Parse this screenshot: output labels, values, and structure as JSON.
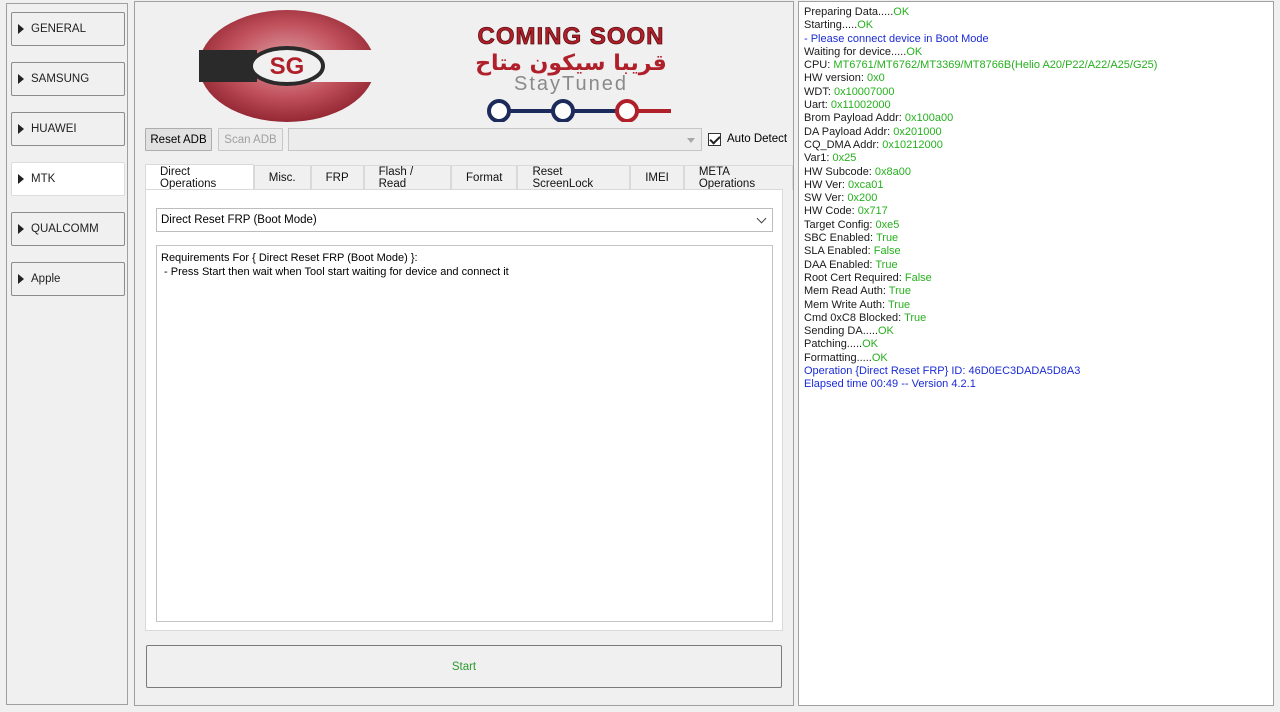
{
  "nav": {
    "items": [
      {
        "label": "GENERAL"
      },
      {
        "label": "SAMSUNG"
      },
      {
        "label": "HUAWEI"
      },
      {
        "label": "MTK",
        "active": true
      },
      {
        "label": "QUALCOMM"
      },
      {
        "label": "Apple"
      }
    ]
  },
  "banner": {
    "logo_text": "SG",
    "headline": "COMING SOON",
    "arabic_line": "قريبا سيكون متاح",
    "tagline": "StayTuned"
  },
  "toolbar": {
    "reset_adb_label": "Reset ADB",
    "scan_adb_label": "Scan ADB",
    "port_value": "",
    "auto_detect_label": "Auto Detect",
    "auto_detect_checked": true
  },
  "tabs": [
    {
      "label": "Direct Operations",
      "active": true
    },
    {
      "label": "Misc."
    },
    {
      "label": "FRP"
    },
    {
      "label": "Flash / Read"
    },
    {
      "label": "Format"
    },
    {
      "label": "Reset ScreenLock"
    },
    {
      "label": "IMEI"
    },
    {
      "label": "META Operations"
    }
  ],
  "operation": {
    "selected": "Direct Reset FRP (Boot Mode)",
    "requirements": "Requirements For { Direct Reset FRP (Boot Mode) }:\n - Press Start then wait when Tool start waiting for device and connect it"
  },
  "start_label": "Start",
  "colors": {
    "log_default": "#1a1a1a",
    "log_value": "#26b01e",
    "log_info": "#1b2bd6",
    "start_text": "#2e9a2e",
    "banner_red": "#b0202a",
    "banner_navy": "#1c2a5c"
  },
  "log": [
    [
      {
        "t": "Preparing Data.....",
        "c": "black"
      },
      {
        "t": "OK",
        "c": "green"
      }
    ],
    [
      {
        "t": "Starting.....",
        "c": "black"
      },
      {
        "t": "OK",
        "c": "green"
      }
    ],
    [
      {
        "t": " - Please connect device in Boot Mode",
        "c": "blue"
      }
    ],
    [
      {
        "t": "Waiting for device.....",
        "c": "black"
      },
      {
        "t": "OK",
        "c": "green"
      }
    ],
    [
      {
        "t": "CPU: ",
        "c": "black"
      },
      {
        "t": "MT6761/MT6762/MT3369/MT8766B(Helio A20/P22/A22/A25/G25)",
        "c": "green"
      }
    ],
    [
      {
        "t": "HW version: ",
        "c": "black"
      },
      {
        "t": "0x0",
        "c": "green"
      }
    ],
    [
      {
        "t": "WDT: ",
        "c": "black"
      },
      {
        "t": "0x10007000",
        "c": "green"
      }
    ],
    [
      {
        "t": "Uart: ",
        "c": "black"
      },
      {
        "t": "0x11002000",
        "c": "green"
      }
    ],
    [
      {
        "t": "Brom Payload Addr: ",
        "c": "black"
      },
      {
        "t": "0x100a00",
        "c": "green"
      }
    ],
    [
      {
        "t": "DA Payload Addr: ",
        "c": "black"
      },
      {
        "t": "0x201000",
        "c": "green"
      }
    ],
    [
      {
        "t": "CQ_DMA Addr: ",
        "c": "black"
      },
      {
        "t": "0x10212000",
        "c": "green"
      }
    ],
    [
      {
        "t": "Var1: ",
        "c": "black"
      },
      {
        "t": "0x25",
        "c": "green"
      }
    ],
    [
      {
        "t": "HW Subcode: ",
        "c": "black"
      },
      {
        "t": "0x8a00",
        "c": "green"
      }
    ],
    [
      {
        "t": "HW Ver: ",
        "c": "black"
      },
      {
        "t": "0xca01",
        "c": "green"
      }
    ],
    [
      {
        "t": "SW Ver: ",
        "c": "black"
      },
      {
        "t": "0x200",
        "c": "green"
      }
    ],
    [
      {
        "t": "HW Code: ",
        "c": "black"
      },
      {
        "t": "0x717",
        "c": "green"
      }
    ],
    [
      {
        "t": "Target Config: ",
        "c": "black"
      },
      {
        "t": "0xe5",
        "c": "green"
      }
    ],
    [
      {
        "t": "SBC Enabled: ",
        "c": "black"
      },
      {
        "t": "True",
        "c": "green"
      }
    ],
    [
      {
        "t": "SLA Enabled: ",
        "c": "black"
      },
      {
        "t": "False",
        "c": "green"
      }
    ],
    [
      {
        "t": "DAA Enabled: ",
        "c": "black"
      },
      {
        "t": "True",
        "c": "green"
      }
    ],
    [
      {
        "t": "Root Cert Required: ",
        "c": "black"
      },
      {
        "t": "False",
        "c": "green"
      }
    ],
    [
      {
        "t": "Mem Read Auth: ",
        "c": "black"
      },
      {
        "t": "True",
        "c": "green"
      }
    ],
    [
      {
        "t": "Mem Write Auth: ",
        "c": "black"
      },
      {
        "t": "True",
        "c": "green"
      }
    ],
    [
      {
        "t": "Cmd 0xC8 Blocked: ",
        "c": "black"
      },
      {
        "t": "True",
        "c": "green"
      }
    ],
    [
      {
        "t": "Sending DA.....",
        "c": "black"
      },
      {
        "t": "OK",
        "c": "green"
      }
    ],
    [
      {
        "t": "Patching.....",
        "c": "black"
      },
      {
        "t": "OK",
        "c": "green"
      }
    ],
    [
      {
        "t": "Formatting.....",
        "c": "black"
      },
      {
        "t": "OK",
        "c": "green"
      }
    ],
    [
      {
        "t": "Operation {Direct Reset FRP} ID: 46D0EC3DADA5D8A3",
        "c": "blue"
      }
    ],
    [
      {
        "t": "Elapsed time 00:49 -- Version 4.2.1",
        "c": "blue"
      }
    ]
  ]
}
